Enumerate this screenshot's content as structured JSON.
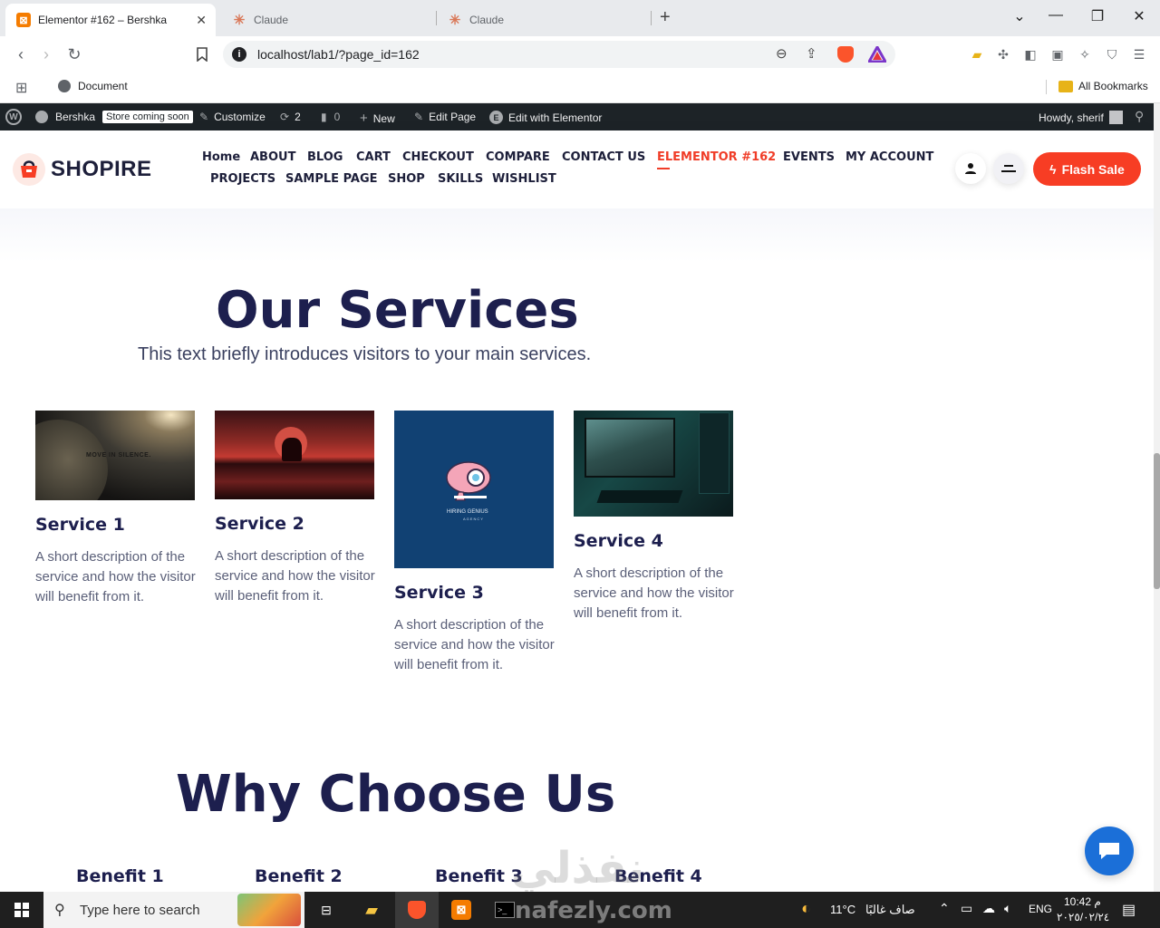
{
  "browser": {
    "tabs": [
      {
        "title": "Elementor #162 – Bershka",
        "active": true
      },
      {
        "title": "Claude",
        "active": false
      },
      {
        "title": "Claude",
        "active": false
      }
    ],
    "new_tab": "+",
    "url": "localhost/lab1/?page_id=162",
    "bookmarks": {
      "document": "Document",
      "all": "All Bookmarks"
    }
  },
  "wp_admin_bar": {
    "site_name": "Bershka",
    "store_badge": "Store coming soon",
    "customize": "Customize",
    "updates_count": "2",
    "comments_count": "0",
    "new": "New",
    "edit_page": "Edit Page",
    "edit_elementor": "Edit with Elementor",
    "howdy": "Howdy, sherif"
  },
  "site_header": {
    "logo": "SHOPIRE",
    "menu": {
      "home": "Home",
      "about": "ABOUT",
      "blog": "BLOG",
      "cart": "CART",
      "checkout": "CHECKOUT",
      "compare": "COMPARE",
      "contact": "CONTACT US",
      "elementor": "ELEMENTOR #162",
      "events": "EVENTS",
      "account": "MY ACCOUNT",
      "projects": "PROJECTS",
      "sample": "SAMPLE PAGE",
      "shop": "SHOP",
      "skills": "SKILLS",
      "wishlist": "WISHLIST"
    },
    "flash_sale": "Flash Sale",
    "accent_color": "#f73d24"
  },
  "services": {
    "title": "Our Services",
    "intro": "This text briefly introduces visitors to your main services.",
    "items": [
      {
        "title": "Service 1",
        "desc": "A short description of the service and how the visitor will benefit from it.",
        "image_text": "MOVE IN SILENCE."
      },
      {
        "title": "Service 2",
        "desc": "A short description of the service and how the visitor will benefit from it."
      },
      {
        "title": "Service 3",
        "desc": "A short description of the service and how the visitor will benefit from it.",
        "image_text": "HIRING GENIUS",
        "image_subtext": "AGENCY"
      },
      {
        "title": "Service 4",
        "desc": "A short description of the service and how the visitor will benefit from it."
      }
    ]
  },
  "why": {
    "title": "Why Choose Us",
    "benefits": [
      "Benefit 1",
      "Benefit 2",
      "Benefit 3",
      "Benefit 4"
    ]
  },
  "taskbar": {
    "search_placeholder": "Type here to search",
    "weather_temp": "11°C",
    "weather_text": "صاف غالبًا",
    "lang": "ENG",
    "time": "10:42 م",
    "date": "٢٠٢٥/٠٢/٢٤"
  },
  "watermark": {
    "arabic": "نفذلي",
    "latin": "nafezly.com"
  }
}
